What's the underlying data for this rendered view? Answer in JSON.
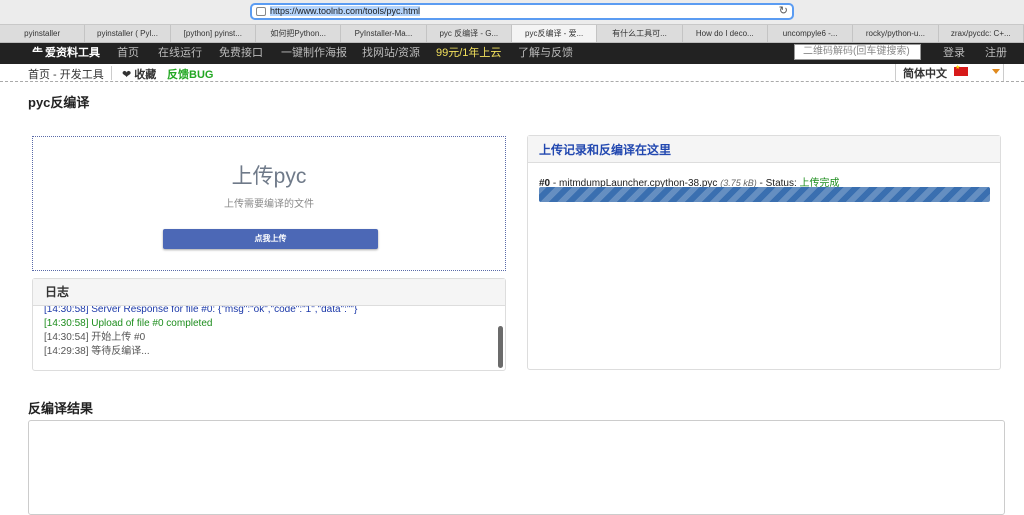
{
  "browser": {
    "url": "https://www.toolnb.com/tools/pyc.html",
    "tabs": [
      {
        "label": "pyinstaller",
        "active": false
      },
      {
        "label": "pyinstaller ( Pyl...",
        "active": false
      },
      {
        "label": "[python] pyinst...",
        "active": false
      },
      {
        "label": "如何把Python...",
        "active": false
      },
      {
        "label": "PyInstaller-Ma...",
        "active": false
      },
      {
        "label": "pyc 反编译 - G...",
        "active": false
      },
      {
        "label": "pyc反编译 - 爱...",
        "active": true
      },
      {
        "label": "有什么工具可...",
        "active": false
      },
      {
        "label": "How do I deco...",
        "active": false
      },
      {
        "label": "uncompyle6 -...",
        "active": false
      },
      {
        "label": "rocky/python-u...",
        "active": false
      },
      {
        "label": "zrax/pycdc: C+...",
        "active": false
      }
    ]
  },
  "nav": {
    "logo": "爱资料工具",
    "logo_mark": "⺧",
    "links": [
      "首页",
      "在线运行",
      "免费接口",
      "一键制作海报",
      "找网站/资源",
      "99元/1年上云",
      "了解与反馈"
    ],
    "search_placeholder": "二维码解码(回车键搜索)",
    "login": "登录",
    "register": "注册"
  },
  "subbar": {
    "breadcrumb": "首页 - 开发工具",
    "favorite": "❤ 收藏",
    "bug": "反馈BUG",
    "language": "简体中文"
  },
  "page_title": "pyc反编译",
  "upload": {
    "heading": "上传pyc",
    "subtitle": "上传需要编译的文件",
    "button": "点我上传"
  },
  "log": {
    "title": "日志",
    "lines": [
      {
        "text": "[14:30:58] Server Response for file #0: {\"msg\":\"ok\",\"code\":\"1\",\"data\":\"\"}",
        "style": "blue"
      },
      {
        "text": "[14:30:58] Upload of file #0 completed",
        "style": "green"
      },
      {
        "text": "[14:30:54] 开始上传 #0",
        "style": "gray"
      },
      {
        "text": "[14:29:38] 等待反编译...",
        "style": "gray"
      }
    ]
  },
  "records": {
    "title": "上传记录和反编译在这里",
    "item": {
      "index": "#0",
      "filename": "mitmdumpLauncher.cpython-38.pyc",
      "size": "(3.75 kB)",
      "status_label": "Status:",
      "status": "上传完成",
      "progress": 1.0
    }
  },
  "result_title": "反编译结果",
  "colors": {
    "nav_bg": "#222222",
    "accent_blue": "#4c68b6",
    "success_green": "#1d8d1d",
    "highlight_yellow": "#f3e15c"
  }
}
